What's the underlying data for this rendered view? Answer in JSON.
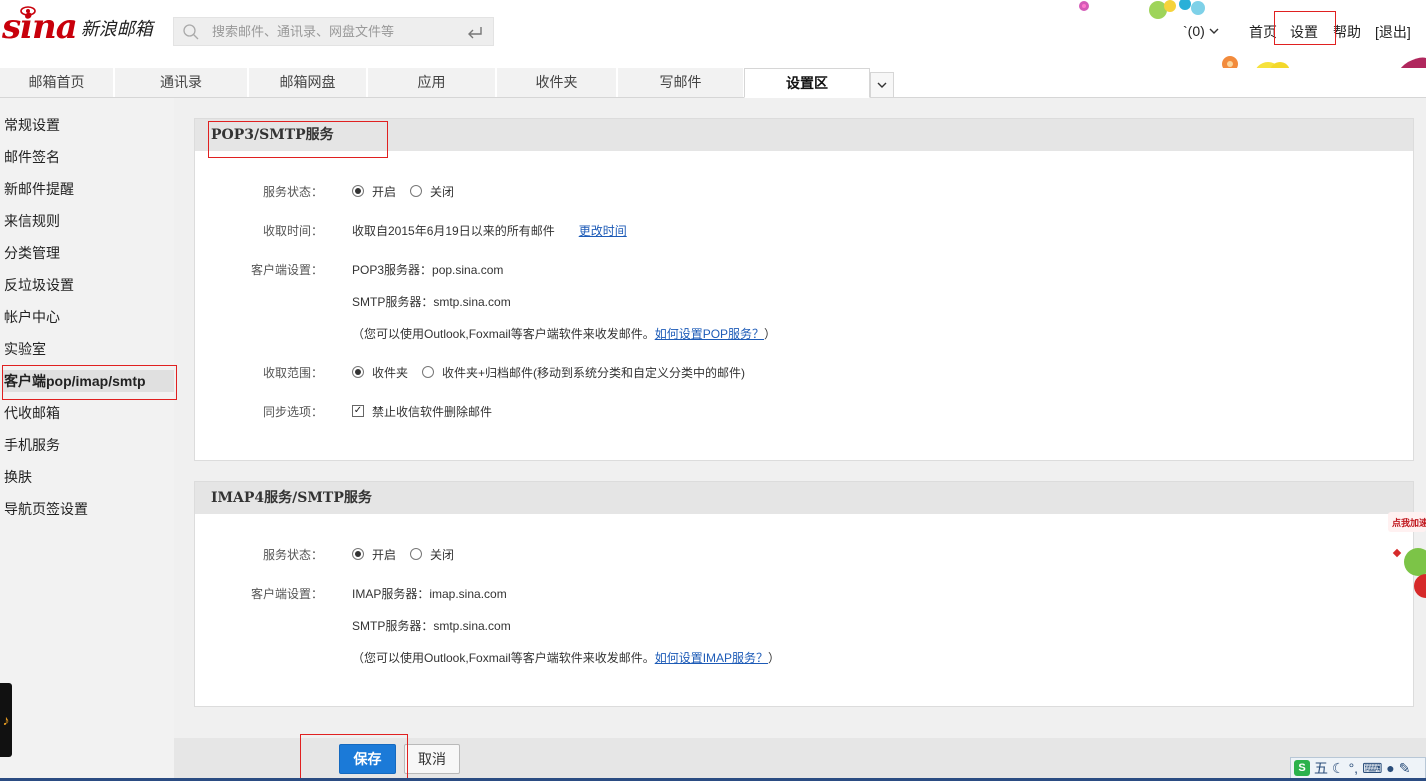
{
  "header": {
    "logo_mark": "sina",
    "logo_text": "新浪邮箱",
    "search_placeholder": "搜索邮件、通讯录、网盘文件等",
    "msg_count": "`(0)",
    "nav": [
      {
        "label": "首页"
      },
      {
        "label": "设置"
      },
      {
        "label": "帮助"
      },
      {
        "label": "[退出]"
      }
    ]
  },
  "tabs": [
    {
      "label": "邮箱首页"
    },
    {
      "label": "通讯录"
    },
    {
      "label": "邮箱网盘"
    },
    {
      "label": "应用"
    },
    {
      "label": "收件夹"
    },
    {
      "label": "写邮件"
    },
    {
      "label": "设置区"
    }
  ],
  "sidebar": {
    "items": [
      {
        "label": "常规设置"
      },
      {
        "label": "邮件签名"
      },
      {
        "label": "新邮件提醒"
      },
      {
        "label": "来信规则"
      },
      {
        "label": "分类管理"
      },
      {
        "label": "反垃圾设置"
      },
      {
        "label": "帐户中心"
      },
      {
        "label": "实验室"
      },
      {
        "label": "客户端pop/imap/smtp"
      },
      {
        "label": "代收邮箱"
      },
      {
        "label": "手机服务"
      },
      {
        "label": "换肤"
      },
      {
        "label": "导航页签设置"
      }
    ],
    "active_index": 8
  },
  "pop3": {
    "title": "POP3/SMTP服务",
    "status_label": "服务状态：",
    "status_on": "开启",
    "status_off": "关闭",
    "status_value": "开启",
    "fetch_time_label": "收取时间：",
    "fetch_time_value": "收取自2015年6月19日以来的所有邮件",
    "change_time_link": "更改时间",
    "client_label": "客户端设置：",
    "pop3_server": "POP3服务器：pop.sina.com",
    "smtp_server": "SMTP服务器：smtp.sina.com",
    "hint_prefix": "（您可以使用Outlook,Foxmail等客户端软件来收发邮件。",
    "hint_link": "如何设置POP服务？",
    "hint_suffix": "）",
    "range_label": "收取范围：",
    "range_opt1": "收件夹",
    "range_opt2": "收件夹+归档邮件(移动到系统分类和自定义分类中的邮件)",
    "range_value": "收件夹",
    "sync_label": "同步选项：",
    "sync_option": "禁止收信软件删除邮件",
    "sync_checked": true
  },
  "imap": {
    "title": "IMAP4服务/SMTP服务",
    "status_label": "服务状态：",
    "status_on": "开启",
    "status_off": "关闭",
    "status_value": "开启",
    "client_label": "客户端设置：",
    "imap_server": "IMAP服务器：imap.sina.com",
    "smtp_server": "SMTP服务器：smtp.sina.com",
    "hint_prefix": "（您可以使用Outlook,Foxmail等客户端软件来收发邮件。",
    "hint_link": "如何设置IMAP服务？",
    "hint_suffix": "）"
  },
  "actions": {
    "save": "保存",
    "cancel": "取消"
  },
  "widget_text": "点我加速",
  "ime": {
    "logo": "S",
    "mode": "五",
    "icons": [
      "moon-icon",
      "punctuation-icon",
      "keyboard-icon",
      "user-icon",
      "tool-icon"
    ]
  },
  "colors": {
    "brand_red": "#c8000b",
    "save_blue": "#1b7ad8",
    "link_blue": "#1d5bb7",
    "annotation_red": "#e02020"
  }
}
